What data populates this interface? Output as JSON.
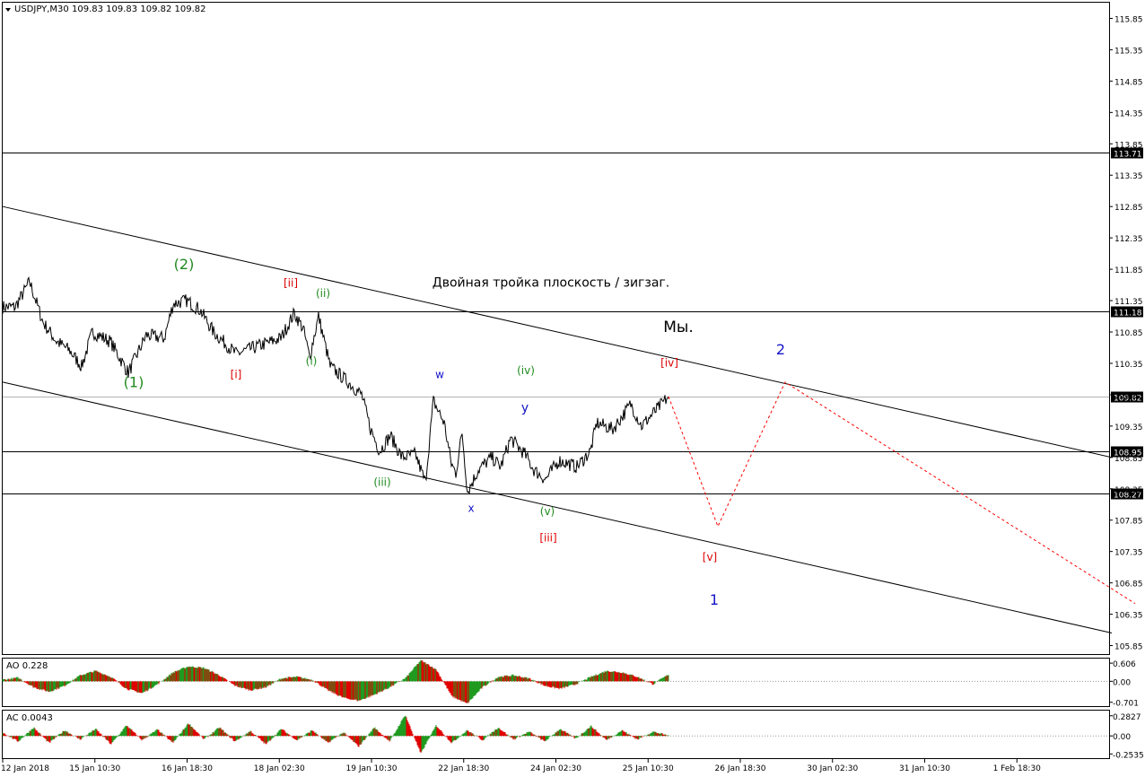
{
  "header": {
    "symbol": "USDJPY,M30",
    "ohlc": "109.83 109.83 109.82 109.82"
  },
  "colors": {
    "price": "#000000",
    "green_label": "#1f8a1f",
    "red_label": "#dd0000",
    "blue_label": "#1414c8",
    "forecast": "#ff0000",
    "histogram_up": "#1f9a1f",
    "histogram_down": "#e00000",
    "axis": "#000000",
    "current_price_line": "#b4b4b4"
  },
  "chart_data": {
    "type": "line",
    "title": "",
    "xlabel": "",
    "ylabel": "",
    "ylim": [
      105.7,
      116.1
    ],
    "y_ticks": [
      "115.85",
      "115.35",
      "114.85",
      "114.35",
      "113.85",
      "113.35",
      "112.85",
      "112.35",
      "111.85",
      "111.35",
      "110.85",
      "110.35",
      "109.85",
      "109.35",
      "108.85",
      "108.35",
      "107.85",
      "107.35",
      "106.85",
      "106.35",
      "105.85"
    ],
    "x_ticks": [
      "12 Jan 2018",
      "15 Jan 10:30",
      "16 Jan 18:30",
      "18 Jan 02:30",
      "19 Jan 10:30",
      "22 Jan 18:30",
      "24 Jan 02:30",
      "25 Jan 10:30",
      "26 Jan 18:30",
      "30 Jan 02:30",
      "31 Jan 10:30",
      "1 Feb 18:30"
    ],
    "horizontal_levels": [
      {
        "label": "113.71",
        "value": 113.71
      },
      {
        "label": "111.18",
        "value": 111.18
      },
      {
        "label": "109.82",
        "value": 109.82,
        "current": true
      },
      {
        "label": "108.95",
        "value": 108.95
      },
      {
        "label": "108.27",
        "value": 108.27
      }
    ],
    "price_path": [
      {
        "t": 0,
        "v": 111.25
      },
      {
        "t": 14,
        "v": 111.25
      },
      {
        "t": 30,
        "v": 111.65
      },
      {
        "t": 45,
        "v": 111.0
      },
      {
        "t": 60,
        "v": 110.7
      },
      {
        "t": 75,
        "v": 110.55
      },
      {
        "t": 88,
        "v": 110.3
      },
      {
        "t": 100,
        "v": 110.85
      },
      {
        "t": 120,
        "v": 110.7
      },
      {
        "t": 140,
        "v": 110.2
      },
      {
        "t": 160,
        "v": 110.8
      },
      {
        "t": 180,
        "v": 110.75
      },
      {
        "t": 190,
        "v": 111.3
      },
      {
        "t": 205,
        "v": 111.35
      },
      {
        "t": 220,
        "v": 111.2
      },
      {
        "t": 235,
        "v": 110.85
      },
      {
        "t": 260,
        "v": 110.5
      },
      {
        "t": 290,
        "v": 110.65
      },
      {
        "t": 310,
        "v": 110.75
      },
      {
        "t": 325,
        "v": 111.15
      },
      {
        "t": 335,
        "v": 110.9
      },
      {
        "t": 342,
        "v": 110.45
      },
      {
        "t": 352,
        "v": 111.1
      },
      {
        "t": 365,
        "v": 110.3
      },
      {
        "t": 385,
        "v": 110.05
      },
      {
        "t": 400,
        "v": 109.85
      },
      {
        "t": 410,
        "v": 109.3
      },
      {
        "t": 420,
        "v": 108.95
      },
      {
        "t": 432,
        "v": 109.2
      },
      {
        "t": 445,
        "v": 108.85
      },
      {
        "t": 460,
        "v": 108.9
      },
      {
        "t": 471,
        "v": 108.45
      },
      {
        "t": 480,
        "v": 109.75
      },
      {
        "t": 492,
        "v": 109.4
      },
      {
        "t": 500,
        "v": 108.75
      },
      {
        "t": 505,
        "v": 108.6
      },
      {
        "t": 512,
        "v": 109.25
      },
      {
        "t": 518,
        "v": 108.3
      },
      {
        "t": 530,
        "v": 108.65
      },
      {
        "t": 545,
        "v": 108.85
      },
      {
        "t": 555,
        "v": 108.7
      },
      {
        "t": 566,
        "v": 109.15
      },
      {
        "t": 582,
        "v": 108.9
      },
      {
        "t": 592,
        "v": 108.65
      },
      {
        "t": 605,
        "v": 108.5
      },
      {
        "t": 620,
        "v": 108.8
      },
      {
        "t": 640,
        "v": 108.7
      },
      {
        "t": 655,
        "v": 108.95
      },
      {
        "t": 662,
        "v": 109.4
      },
      {
        "t": 680,
        "v": 109.3
      },
      {
        "t": 700,
        "v": 109.7
      },
      {
        "t": 712,
        "v": 109.35
      },
      {
        "t": 728,
        "v": 109.6
      },
      {
        "t": 742,
        "v": 109.82
      }
    ],
    "forecast_path": [
      {
        "t": 742,
        "v": 109.82
      },
      {
        "t": 797,
        "v": 107.75
      },
      {
        "t": 872,
        "v": 110.05
      },
      {
        "t": 1262,
        "v": 106.52
      }
    ],
    "channel_lines": [
      {
        "from": {
          "t": 0,
          "v": 112.85
        },
        "to": {
          "t": 1236,
          "v": 108.85
        }
      },
      {
        "from": {
          "t": 0,
          "v": 110.05
        },
        "to": {
          "t": 1236,
          "v": 106.05
        }
      }
    ],
    "annotations": [
      {
        "text": "(2)",
        "t": 202,
        "v": 111.85,
        "color": "green_label",
        "size": 16
      },
      {
        "text": "(1)",
        "t": 146,
        "v": 109.97,
        "color": "green_label",
        "size": 16
      },
      {
        "text": "[ii]",
        "t": 321,
        "v": 111.57,
        "color": "red_label",
        "size": 12
      },
      {
        "text": "(ii)",
        "t": 357,
        "v": 111.41,
        "color": "green_label",
        "size": 12
      },
      {
        "text": "[i]",
        "t": 260,
        "v": 110.11,
        "color": "red_label",
        "size": 12
      },
      {
        "text": "(i)",
        "t": 344,
        "v": 110.33,
        "color": "green_label",
        "size": 12
      },
      {
        "text": "Двойная тройка плоскость / зигзаг.",
        "t": 611,
        "v": 111.57,
        "color": "price",
        "size": 14
      },
      {
        "text": "Мы.",
        "t": 753,
        "v": 110.85,
        "color": "price",
        "size": 17
      },
      {
        "text": "2",
        "t": 867,
        "v": 110.49,
        "color": "blue_label",
        "size": 16
      },
      {
        "text": "[iv]",
        "t": 743,
        "v": 110.3,
        "color": "red_label",
        "size": 12
      },
      {
        "text": "w",
        "t": 487,
        "v": 110.11,
        "color": "blue_label",
        "size": 12
      },
      {
        "text": "(iv)",
        "t": 583,
        "v": 110.18,
        "color": "green_label",
        "size": 12
      },
      {
        "text": "y",
        "t": 582,
        "v": 109.58,
        "color": "blue_label",
        "size": 14
      },
      {
        "text": "(iii)",
        "t": 423,
        "v": 108.4,
        "color": "green_label",
        "size": 12
      },
      {
        "text": "x",
        "t": 522,
        "v": 107.98,
        "color": "blue_label",
        "size": 12
      },
      {
        "text": "(v)",
        "t": 607,
        "v": 107.93,
        "color": "green_label",
        "size": 12
      },
      {
        "text": "[iii]",
        "t": 608,
        "v": 107.51,
        "color": "red_label",
        "size": 12
      },
      {
        "text": "[v]",
        "t": 788,
        "v": 107.2,
        "color": "red_label",
        "size": 12
      },
      {
        "text": "1",
        "t": 793,
        "v": 106.5,
        "color": "blue_label",
        "size": 16
      }
    ],
    "grid": false
  },
  "indicators": {
    "ao": {
      "label": "AO 0.228",
      "ticks": [
        "0.606",
        "0.00",
        "-0.701"
      ],
      "range": [
        -0.8,
        0.7
      ],
      "values": [
        0.05,
        0.12,
        -0.2,
        -0.35,
        -0.15,
        0.2,
        0.35,
        0.15,
        -0.25,
        -0.4,
        -0.1,
        0.3,
        0.5,
        0.45,
        0.2,
        -0.15,
        -0.3,
        -0.2,
        0.1,
        0.15,
        0.05,
        -0.3,
        -0.55,
        -0.65,
        -0.45,
        -0.2,
        0.1,
        0.7,
        0.4,
        -0.5,
        -0.75,
        -0.2,
        0.15,
        0.2,
        0.1,
        -0.15,
        -0.25,
        -0.1,
        0.15,
        0.35,
        0.3,
        0.15,
        -0.1,
        0.228
      ]
    },
    "ac": {
      "label": "AC 0.0043",
      "ticks": [
        "0.2827",
        "0.00",
        "-0.2535"
      ],
      "range": [
        -0.3,
        0.33
      ],
      "values": [
        0.05,
        -0.08,
        0.12,
        -0.1,
        0.08,
        -0.05,
        0.1,
        -0.12,
        0.15,
        -0.06,
        0.09,
        -0.1,
        0.18,
        -0.05,
        0.12,
        -0.08,
        0.07,
        -0.12,
        0.1,
        -0.06,
        0.08,
        -0.1,
        0.05,
        -0.15,
        0.12,
        -0.08,
        0.3,
        -0.25,
        0.15,
        -0.1,
        0.08,
        -0.06,
        0.12,
        -0.05,
        0.06,
        -0.08,
        0.1,
        -0.04,
        0.14,
        -0.06,
        0.08,
        -0.05,
        0.06,
        0.0043
      ]
    }
  }
}
